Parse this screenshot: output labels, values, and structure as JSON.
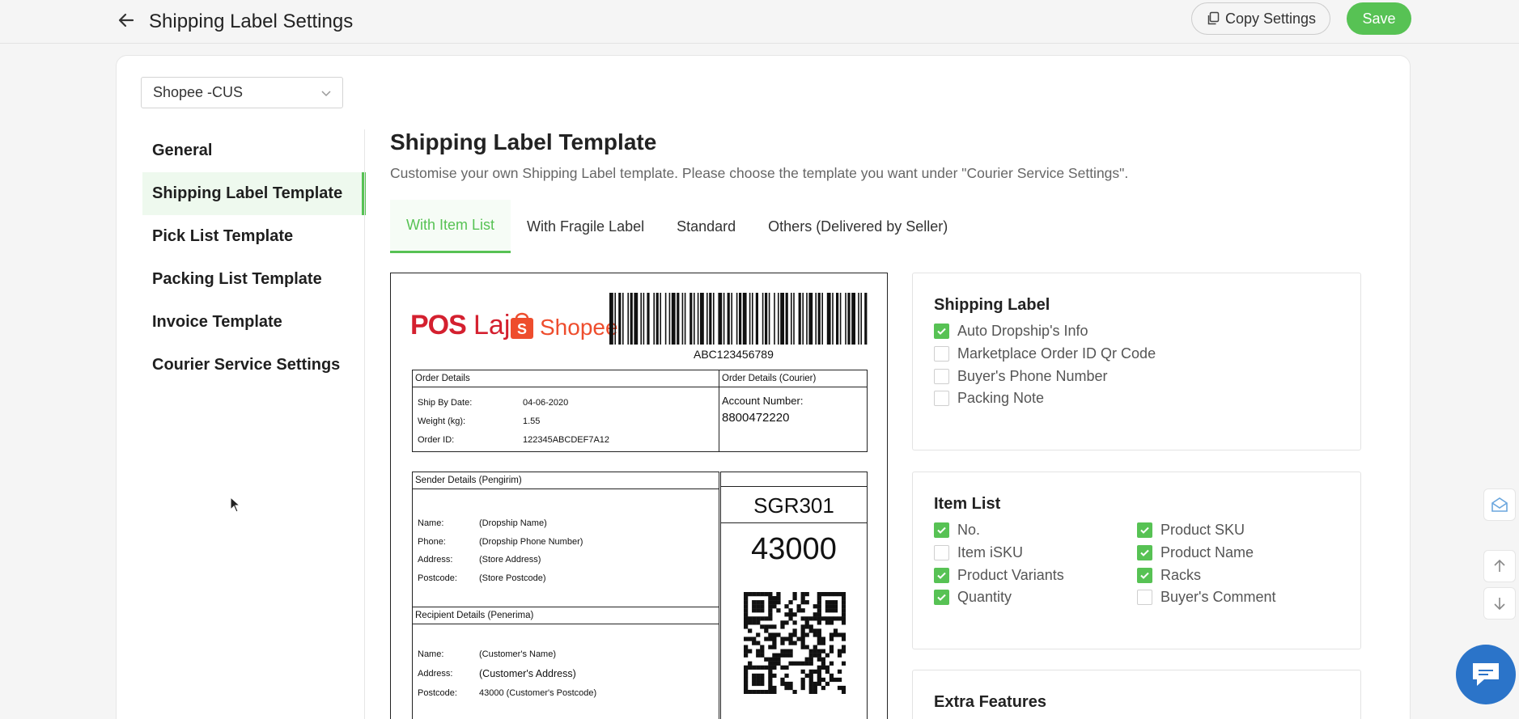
{
  "header": {
    "title": "Shipping Label Settings",
    "copy_label": "Copy Settings",
    "save_label": "Save"
  },
  "store_select": {
    "value": "Shopee -CUS"
  },
  "sidebar": {
    "items": [
      {
        "label": "General"
      },
      {
        "label": "Shipping Label Template",
        "active": true
      },
      {
        "label": "Pick List Template"
      },
      {
        "label": "Packing List Template"
      },
      {
        "label": "Invoice Template"
      },
      {
        "label": "Courier Service Settings"
      }
    ]
  },
  "main": {
    "title": "Shipping Label Template",
    "subtitle": "Customise your own Shipping Label template. Please choose the template you want under \"Courier Service Settings\".",
    "tabs": [
      {
        "label": "With Item List",
        "active": true
      },
      {
        "label": "With Fragile Label"
      },
      {
        "label": "Standard"
      },
      {
        "label": "Others (Delivered by Seller)"
      }
    ]
  },
  "label_preview": {
    "logo_pos": "POS",
    "logo_laju": "Laju",
    "logo_shopee": "Shopee",
    "barcode_number": "ABC123456789",
    "order_details": {
      "heading": "Order Details",
      "ship_by_label": "Ship By Date:",
      "ship_by_value": "04-06-2020",
      "weight_label": "Weight (kg):",
      "weight_value": "1.55",
      "order_id_label": "Order ID:",
      "order_id_value": "122345ABCDEF7A12"
    },
    "courier": {
      "heading": "Order Details (Courier)",
      "account_label": "Account Number:",
      "account_value": "8800472220"
    },
    "sender": {
      "heading": "Sender Details (Pengirim)",
      "name_label": "Name:",
      "name_value": "(Dropship Name)",
      "phone_label": "Phone:",
      "phone_value": "(Dropship Phone Number)",
      "address_label": "Address:",
      "address_value": "(Store Address)",
      "postcode_label": "Postcode:",
      "postcode_value": "(Store Postcode)"
    },
    "recipient": {
      "heading": "Recipient Details (Penerima)",
      "name_label": "Name:",
      "name_value": "(Customer's Name)",
      "address_label": "Address:",
      "address_value": "(Customer's Address)",
      "postcode_label": "Postcode:",
      "postcode_value": "43000 (Customer's Postcode)"
    },
    "routing_code": "SGR301",
    "postcode_big": "43000"
  },
  "shipping_label_panel": {
    "title": "Shipping Label",
    "options": [
      {
        "label": "Auto Dropship's Info",
        "checked": true
      },
      {
        "label": "Marketplace Order ID Qr Code",
        "checked": false
      },
      {
        "label": "Buyer's Phone Number",
        "checked": false
      },
      {
        "label": "Packing Note",
        "checked": false
      }
    ]
  },
  "item_list_panel": {
    "title": "Item List",
    "options": [
      {
        "label": "No.",
        "checked": true
      },
      {
        "label": "Product SKU",
        "checked": true
      },
      {
        "label": "Item iSKU",
        "checked": false
      },
      {
        "label": "Product Name",
        "checked": true
      },
      {
        "label": "Product Variants",
        "checked": true
      },
      {
        "label": "Racks",
        "checked": true
      },
      {
        "label": "Quantity",
        "checked": true
      },
      {
        "label": "Buyer's Comment",
        "checked": false
      }
    ]
  },
  "extra_panel": {
    "title": "Extra Features"
  },
  "colors": {
    "accent": "#57c254",
    "chat": "#2b74c9",
    "pos_red": "#d4202f",
    "shopee_orange": "#ee4d2d"
  },
  "icons": {
    "back": "arrow-left-icon",
    "copy": "copy-icon",
    "chevron": "chevron-down-icon",
    "mail": "mail-icon",
    "up": "arrow-up-icon",
    "down": "arrow-down-icon",
    "chat": "chat-bubble-icon"
  }
}
